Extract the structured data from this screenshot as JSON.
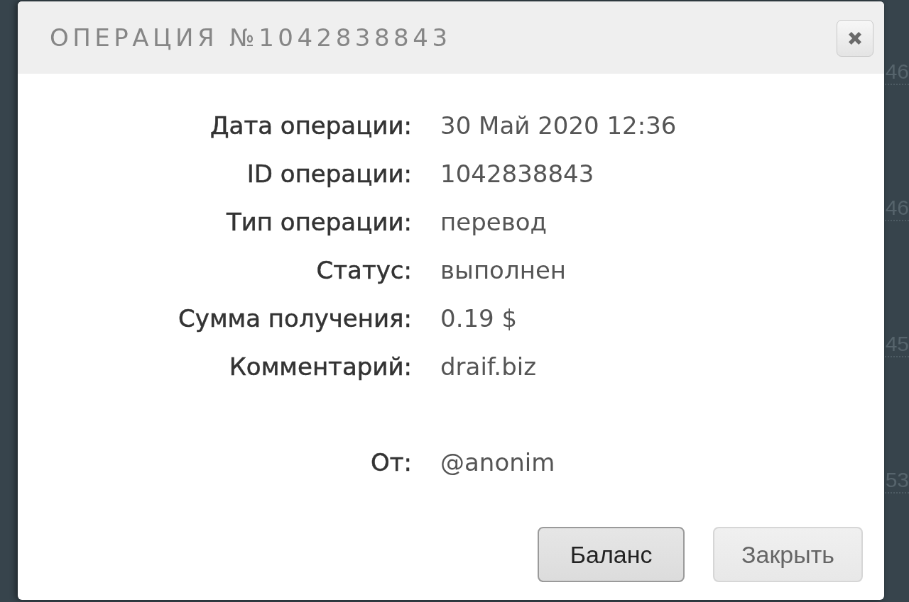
{
  "background_list": [
    {
      "text": "46"
    },
    {
      "text": "46"
    },
    {
      "text": "45"
    },
    {
      "text": "53"
    }
  ],
  "dialog": {
    "title": "ОПЕРАЦИЯ №1042838843",
    "details": [
      {
        "label": "Дата операции:",
        "value": "30 Май 2020 12:36"
      },
      {
        "label": "ID операции:",
        "value": "1042838843"
      },
      {
        "label": "Тип операции:",
        "value": "перевод"
      },
      {
        "label": "Статус:",
        "value": "выполнен"
      },
      {
        "label": "Сумма получения:",
        "value": "0.19 $"
      },
      {
        "label": "Комментарий:",
        "value": "draif.biz"
      }
    ],
    "sender": {
      "label": "От:",
      "value": "@anonim"
    },
    "buttons": [
      {
        "label": "Баланс",
        "focused": true
      },
      {
        "label": "Закрыть",
        "focused": false
      }
    ]
  }
}
